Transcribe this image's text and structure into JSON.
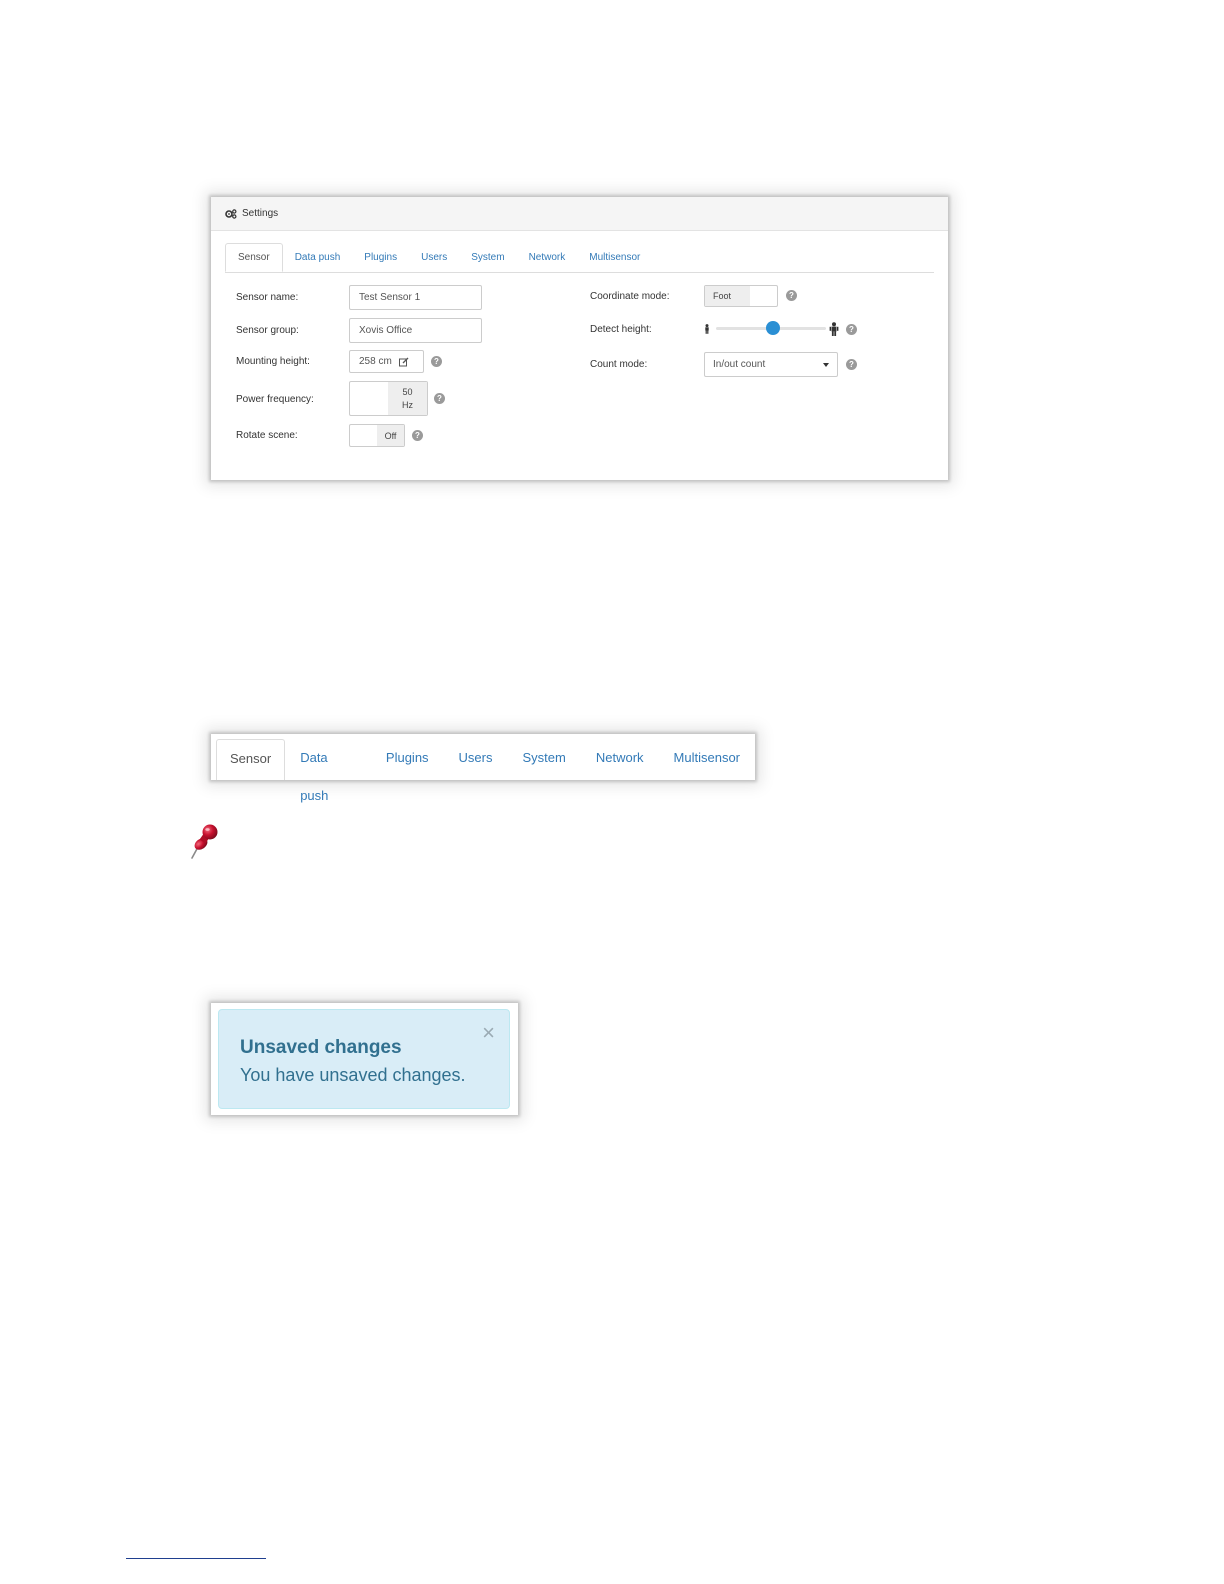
{
  "settings_panel": {
    "title": "Settings",
    "tabs": [
      {
        "label": "Sensor",
        "active": true
      },
      {
        "label": "Data push",
        "active": false
      },
      {
        "label": "Plugins",
        "active": false
      },
      {
        "label": "Users",
        "active": false
      },
      {
        "label": "System",
        "active": false
      },
      {
        "label": "Network",
        "active": false
      },
      {
        "label": "Multisensor",
        "active": false
      }
    ],
    "fields": {
      "sensor_name": {
        "label": "Sensor name:",
        "value": "Test Sensor 1"
      },
      "sensor_group": {
        "label": "Sensor group:",
        "value": "Xovis Office"
      },
      "mounting_height": {
        "label": "Mounting height:",
        "value": "258 cm"
      },
      "power_frequency": {
        "label": "Power frequency:",
        "value_line1": "50",
        "value_line2": "Hz"
      },
      "rotate_scene": {
        "label": "Rotate scene:",
        "value": "Off"
      },
      "coordinate_mode": {
        "label": "Coordinate mode:",
        "value": "Foot"
      },
      "detect_height": {
        "label": "Detect height:",
        "level": 0.5
      },
      "count_mode": {
        "label": "Count mode:",
        "value": "In/out count"
      }
    },
    "help_glyph": "?"
  },
  "tabs_strip": {
    "tabs": [
      {
        "label": "Sensor",
        "active": true
      },
      {
        "label": "Data push",
        "active": false
      },
      {
        "label": "Plugins",
        "active": false
      },
      {
        "label": "Users",
        "active": false
      },
      {
        "label": "System",
        "active": false
      },
      {
        "label": "Network",
        "active": false
      },
      {
        "label": "Multisensor",
        "active": false
      }
    ]
  },
  "alert": {
    "title": "Unsaved changes",
    "message": "You have unsaved changes.",
    "close_glyph": "×"
  },
  "colors": {
    "link": "#337ab7",
    "slider_knob": "#2a8fd4",
    "alert_bg": "#d9edf7",
    "alert_text": "#31708f",
    "pin": "#c8102e"
  },
  "icons": {
    "settings": "gears-icon",
    "pin": "pushpin-icon",
    "edit": "edit-icon",
    "person_small": "person-small-icon",
    "person_large": "person-large-icon"
  }
}
